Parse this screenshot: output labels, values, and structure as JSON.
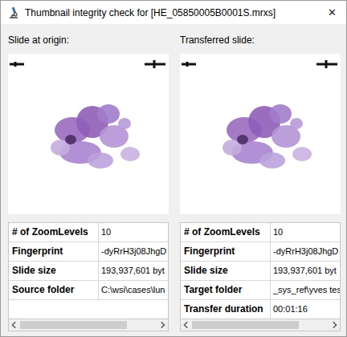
{
  "window": {
    "title": "Thumbnail integrity check for [HE_05850005B0001S.mrxs]",
    "close": "✕"
  },
  "panels": [
    {
      "caption": "Slide at origin:",
      "properties": [
        {
          "label": "# of ZoomLevels",
          "value": "10"
        },
        {
          "label": "Fingerprint",
          "value": "-dyRrH3j08JhgD"
        },
        {
          "label": "Slide size",
          "value": "193,937,601 byt"
        },
        {
          "label": "Source folder",
          "value": "C:\\wsi\\cases\\lun"
        }
      ],
      "scroll": {
        "level": 0.78
      }
    },
    {
      "caption": "Transferred slide:",
      "properties": [
        {
          "label": "# of ZoomLevels",
          "value": "10"
        },
        {
          "label": "Fingerprint",
          "value": "-dyRrH3j08JhgD"
        },
        {
          "label": "Slide size",
          "value": "193,937,601 byt"
        },
        {
          "label": "Target folder",
          "value": "_sys_ref\\yves tes"
        },
        {
          "label": "Transfer duration",
          "value": "00:01:16"
        }
      ],
      "scroll": {
        "level": 0.78
      }
    }
  ]
}
